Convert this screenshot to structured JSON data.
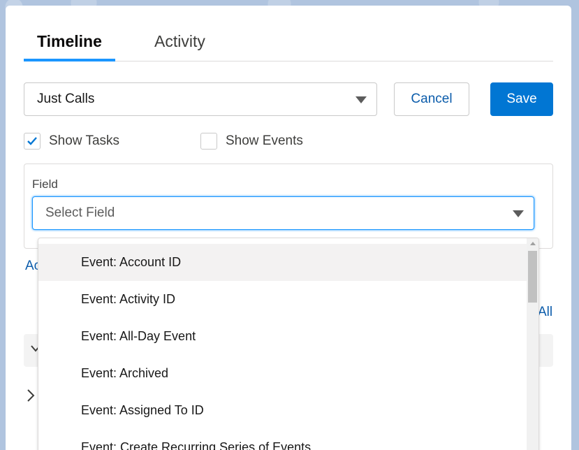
{
  "tabs": [
    {
      "label": "Timeline",
      "active": true
    },
    {
      "label": "Activity",
      "active": false
    }
  ],
  "filter_select": {
    "value": "Just Calls"
  },
  "buttons": {
    "cancel": "Cancel",
    "save": "Save"
  },
  "checkboxes": {
    "show_tasks": {
      "label": "Show Tasks",
      "checked": true
    },
    "show_events": {
      "label": "Show Events",
      "checked": false
    }
  },
  "field": {
    "label": "Field",
    "placeholder": "Select Field",
    "options": [
      "Event: Account ID",
      "Event: Activity ID",
      "Event: All-Day Event",
      "Event: Archived",
      "Event: Assigned To ID",
      "Event: Create Recurring Series of Events"
    ],
    "highlighted_index": 0
  },
  "partial": {
    "add_link": "Ac",
    "all_link": "All"
  },
  "colors": {
    "accent": "#0176d3",
    "link": "#0b5cab",
    "focus": "#1b96ff"
  }
}
